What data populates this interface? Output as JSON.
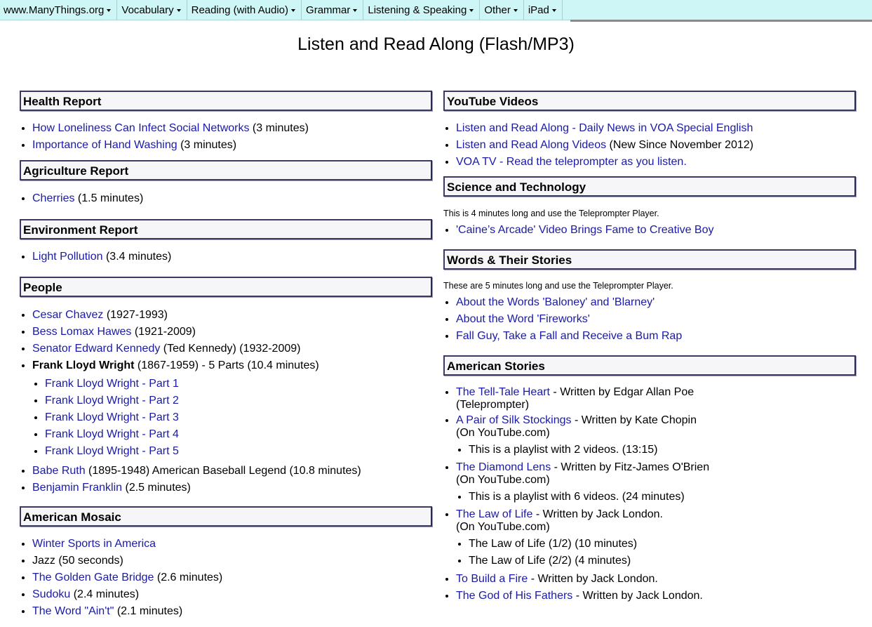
{
  "nav": {
    "items": [
      {
        "label": "www.ManyThings.org"
      },
      {
        "label": "Vocabulary"
      },
      {
        "label": "Reading (with Audio)"
      },
      {
        "label": "Grammar"
      },
      {
        "label": "Listening & Speaking"
      },
      {
        "label": "Other"
      },
      {
        "label": "iPad"
      }
    ]
  },
  "page": {
    "title": "Listen and Read Along (Flash/MP3)"
  },
  "left": {
    "health": {
      "title": "Health Report",
      "items": [
        {
          "link": "How Loneliness Can Infect Social Networks",
          "rest": " (3 minutes)"
        },
        {
          "link": "Importance of Hand Washing",
          "rest": " (3 minutes)"
        }
      ]
    },
    "agriculture": {
      "title": "Agriculture Report",
      "items": [
        {
          "link": "Cherries",
          "rest": " (1.5 minutes)"
        }
      ]
    },
    "environment": {
      "title": "Environment Report",
      "items": [
        {
          "link": "Light Pollution",
          "rest": " (3.4 minutes)"
        }
      ]
    },
    "people": {
      "title": "People",
      "items": [
        {
          "link": "Cesar Chavez",
          "rest": " (1927-1993)"
        },
        {
          "link": "Bess Lomax Hawes",
          "rest": " (1921-2009)"
        },
        {
          "link": "Senator Edward Kennedy",
          "rest": " (Ted Kennedy) (1932-2009)"
        }
      ],
      "flw": {
        "name": "Frank Lloyd Wright",
        "rest": " (1867-1959) - 5 Parts (10.4 minutes)",
        "parts": [
          "Frank Lloyd Wright - Part 1",
          "Frank Lloyd Wright - Part 2",
          "Frank Lloyd Wright - Part 3",
          "Frank Lloyd Wright - Part 4",
          "Frank Lloyd Wright - Part 5"
        ]
      },
      "items2": [
        {
          "link": "Babe Ruth",
          "rest": " (1895-1948) American Baseball Legend (10.8 minutes)"
        },
        {
          "link": "Benjamin Franklin",
          "rest": " (2.5 minutes)"
        }
      ]
    },
    "mosaic": {
      "title": "American Mosaic",
      "items": [
        {
          "link": "Winter Sports in America",
          "rest": ""
        },
        {
          "link": "",
          "rest": "Jazz (50 seconds)"
        },
        {
          "link": "The Golden Gate Bridge",
          "rest": " (2.6 minutes)"
        },
        {
          "link": "Sudoku",
          "rest": " (2.4 minutes)"
        },
        {
          "link": "The Word \"Ain't\"",
          "rest": " (2.1 minutes)"
        }
      ]
    }
  },
  "right": {
    "youtube": {
      "title": "YouTube Videos",
      "items": [
        {
          "link": "Listen and Read Along - Daily News in VOA Special English",
          "rest": ""
        },
        {
          "link": "Listen and Read Along Videos",
          "rest": " (New Since November 2012)"
        },
        {
          "link": "VOA TV - Read the teleprompter as you listen.",
          "rest": ""
        }
      ]
    },
    "science": {
      "title": "Science and Technology",
      "note": "This is 4 minutes long and use the Teleprompter Player.",
      "items": [
        {
          "link": "'Caine’s Arcade' Video Brings Fame to Creative Boy",
          "rest": ""
        }
      ]
    },
    "words": {
      "title": "Words & Their Stories",
      "note": "These are 5 minutes long and use the Teleprompter Player.",
      "items": [
        {
          "link": "About the Words 'Baloney' and 'Blarney'",
          "rest": ""
        },
        {
          "link": "About the Word 'Fireworks'",
          "rest": ""
        },
        {
          "link": "Fall Guy, Take a Fall and Receive a Bum Rap",
          "rest": ""
        }
      ]
    },
    "stories": {
      "title": "American Stories",
      "s1": {
        "link": "The Tell-Tale Heart",
        "rest": " - Written by Edgar Allan Poe",
        "line2": "(Teleprompter)"
      },
      "s2": {
        "link": "A Pair of Silk Stockings",
        "rest": " - Written by Kate Chopin",
        "line2": "(On YouTube.com)",
        "sub": [
          "This is a playlist with 2 videos. (13:15)"
        ]
      },
      "s3": {
        "link": "The Diamond Lens",
        "rest": " - Written by Fitz-James O'Brien",
        "line2": "(On YouTube.com)",
        "sub": [
          "This is a playlist with 6 videos. (24 minutes)"
        ]
      },
      "s4": {
        "link": "The Law of Life",
        "rest": " - Written by Jack London.",
        "line2": "(On YouTube.com)",
        "sub": [
          "The Law of Life (1/2) (10 minutes)",
          "The Law of Life (2/2) (4 minutes)"
        ]
      },
      "s5": {
        "link": "To Build a Fire",
        "rest": " - Written by Jack London."
      },
      "s6": {
        "link": "The God of His Fathers",
        "rest": " - Written by Jack London."
      }
    }
  }
}
